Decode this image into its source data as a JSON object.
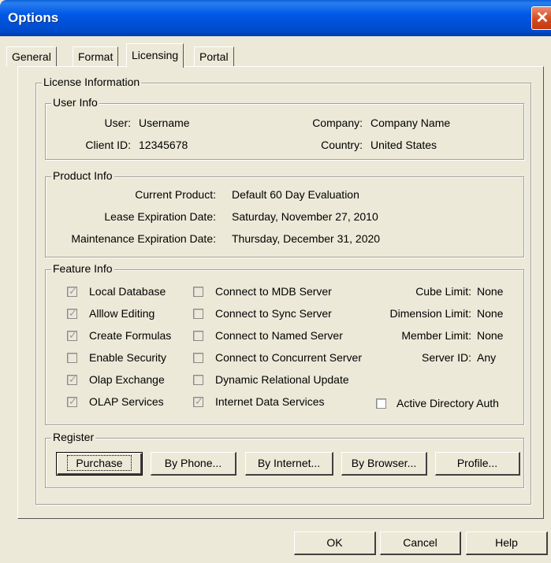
{
  "window": {
    "title": "Options",
    "close_glyph": "✕"
  },
  "tabs": [
    {
      "label": "General"
    },
    {
      "label": "Format"
    },
    {
      "label": "Licensing"
    },
    {
      "label": "Portal"
    }
  ],
  "license": {
    "legend": "License Information",
    "user_info": {
      "legend": "User Info",
      "user_label": "User:",
      "user_value": "Username",
      "client_id_label": "Client ID:",
      "client_id_value": "12345678",
      "company_label": "Company:",
      "company_value": "Company Name",
      "country_label": "Country:",
      "country_value": "United States"
    },
    "product_info": {
      "legend": "Product Info",
      "current_product_label": "Current Product:",
      "current_product_value": "Default 60 Day Evaluation",
      "lease_label": "Lease Expiration Date:",
      "lease_value": "Saturday, November 27, 2010",
      "maintenance_label": "Maintenance Expiration Date:",
      "maintenance_value": "Thursday, December 31, 2020"
    },
    "feature_info": {
      "legend": "Feature Info",
      "col1": [
        {
          "label": "Local Database",
          "checked": true
        },
        {
          "label": "Alllow Editing",
          "checked": true
        },
        {
          "label": "Create Formulas",
          "checked": true
        },
        {
          "label": "Enable Security",
          "checked": false
        },
        {
          "label": "Olap Exchange",
          "checked": true
        },
        {
          "label": "OLAP Services",
          "checked": true
        }
      ],
      "col2": [
        {
          "label": "Connect to MDB Server",
          "checked": false
        },
        {
          "label": "Connect to Sync Server",
          "checked": false
        },
        {
          "label": "Connect to Named Server",
          "checked": false
        },
        {
          "label": "Connect to Concurrent Server",
          "checked": false
        },
        {
          "label": "Dynamic Relational Update",
          "checked": false
        },
        {
          "label": "Internet Data Services",
          "checked": true
        }
      ],
      "limits": [
        {
          "label": "Cube Limit:",
          "value": "None"
        },
        {
          "label": "Dimension Limit:",
          "value": "None"
        },
        {
          "label": "Member Limit:",
          "value": "None"
        },
        {
          "label": "Server ID:",
          "value": "Any"
        }
      ],
      "active_directory": {
        "label": "Active Directory Auth",
        "checked": false
      }
    },
    "register": {
      "legend": "Register",
      "purchase": "Purchase",
      "by_phone": "By Phone...",
      "by_internet": "By Internet...",
      "by_browser": "By Browser...",
      "profile": "Profile..."
    }
  },
  "footer": {
    "ok": "OK",
    "cancel": "Cancel",
    "help": "Help"
  },
  "check_glyph": "✓"
}
